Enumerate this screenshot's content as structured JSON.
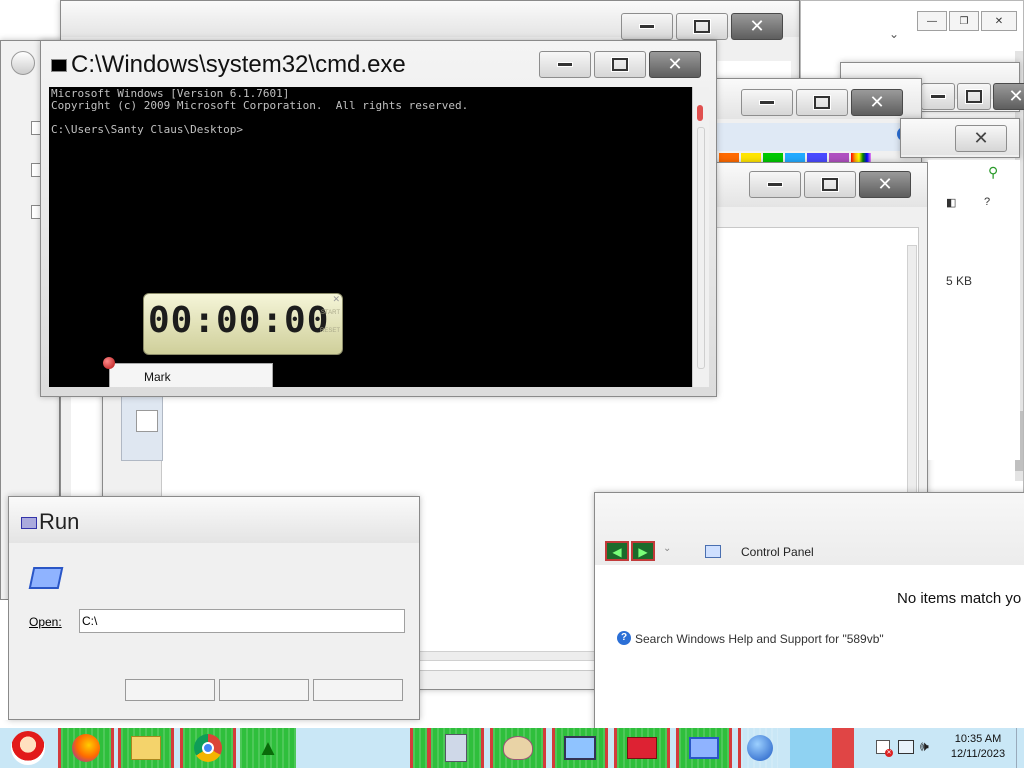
{
  "cmd": {
    "title": "C:\\Windows\\system32\\cmd.exe",
    "lines": [
      "Microsoft Windows [Version 6.1.7601]",
      "Copyright (c) 2009 Microsoft Corporation.  All rights reserved.",
      "",
      "C:\\Users\\Santy Claus\\Desktop>"
    ],
    "context_menu_item": "Mark"
  },
  "stopwatch": {
    "time": "00:00:00",
    "start_label": "START",
    "reset_label": "RESET"
  },
  "run_dialog": {
    "title": "Run",
    "open_label": "Open:",
    "open_value": "C:\\"
  },
  "explorer": {
    "size_value": "5 KB",
    "help_glyph": "?"
  },
  "control_panel": {
    "address": "Control Panel",
    "no_items": "No items match yo",
    "search_help": "Search Windows Help and Support for \"589vb\""
  },
  "paint": {
    "swatches": [
      "#ff6a00",
      "#ffe400",
      "#00c800",
      "#22aaff",
      "#4a4aff",
      "#b050c0",
      "#e040a0"
    ]
  },
  "taskbar": {
    "time": "10:35 AM",
    "date": "12/11/2023"
  }
}
